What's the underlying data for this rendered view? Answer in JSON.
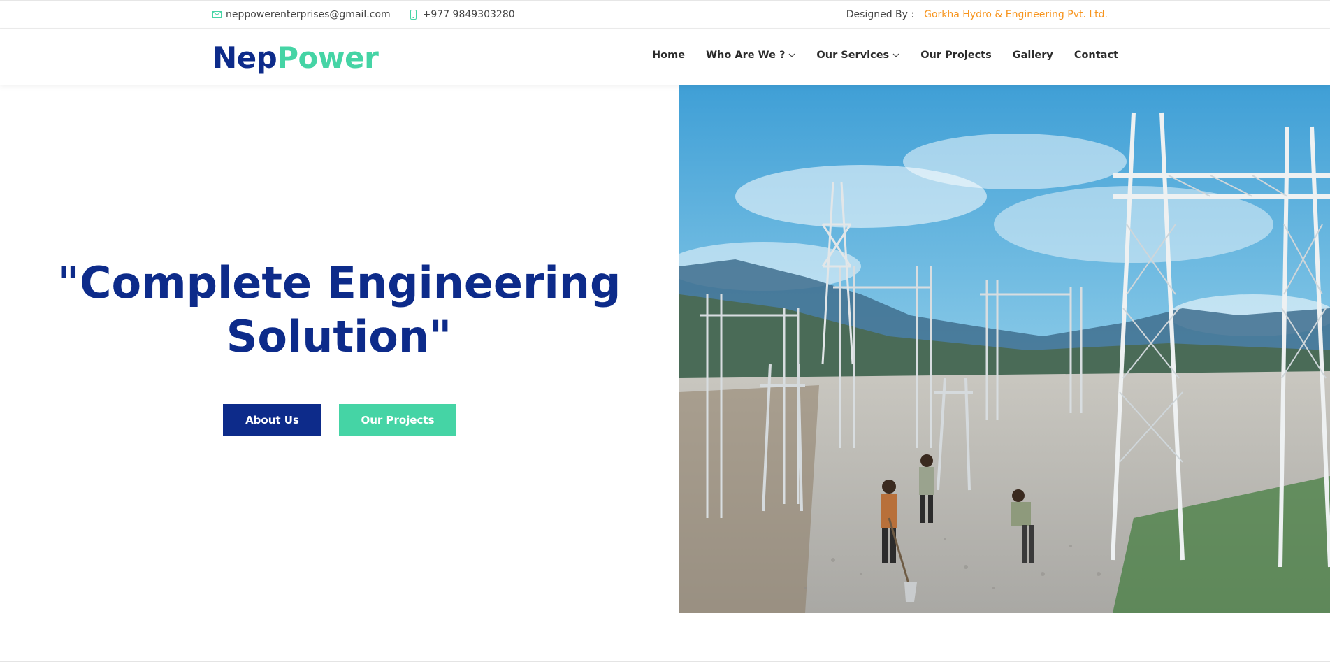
{
  "topbar": {
    "email": "neppowerenterprises@gmail.com",
    "phone": "+977 9849303280",
    "designed_by_label": "Designed By :",
    "designed_by_company": "Gorkha Hydro & Engineering Pvt. Ltd.",
    "email_icon": "envelope-icon",
    "phone_icon": "mobile-phone-icon"
  },
  "header": {
    "logo_part1": "Nep",
    "logo_part2": "Power",
    "nav": [
      {
        "label": "Home",
        "dropdown": false
      },
      {
        "label": "Who Are We ?",
        "dropdown": true
      },
      {
        "label": "Our Services",
        "dropdown": true
      },
      {
        "label": "Our Projects",
        "dropdown": false
      },
      {
        "label": "Gallery",
        "dropdown": false
      },
      {
        "label": "Contact",
        "dropdown": false
      }
    ]
  },
  "hero": {
    "headline_line1": "\"Complete Engineering",
    "headline_line2": "Solution\"",
    "about_button": "About Us",
    "projects_button": "Our Projects",
    "image": "electrical-substation-construction-photo"
  },
  "colors": {
    "primary_navy": "#0d2b8a",
    "accent_green": "#45d4a5",
    "link_orange": "#f7941d",
    "sky": "#4aa9d8"
  }
}
